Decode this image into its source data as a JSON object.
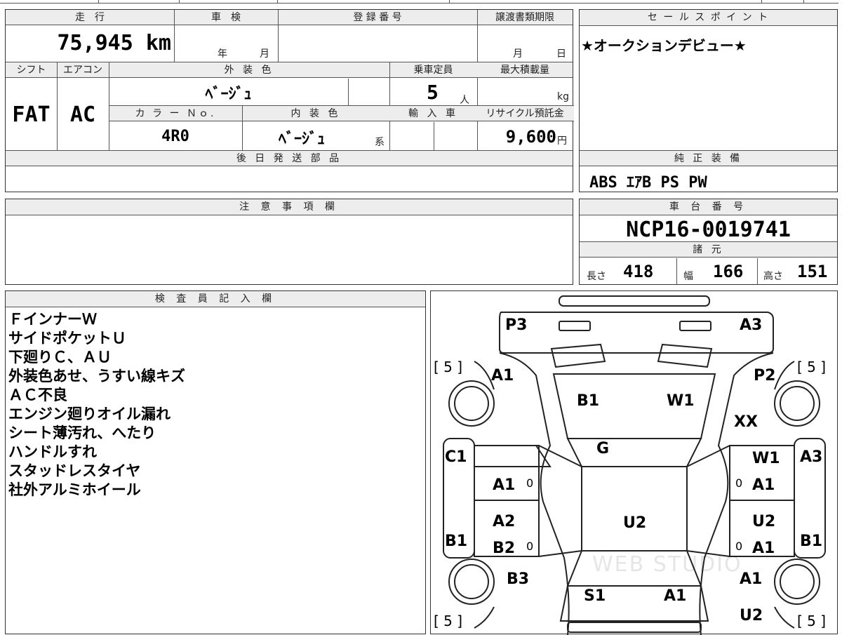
{
  "vehicle": {
    "mileage_label": "走　行",
    "mileage": "75,945 km",
    "shaken_label": "車　検",
    "shaken_year_unit": "年",
    "shaken_month_unit": "月",
    "registration_label": "登 録 番 号",
    "transfer_deadline_label": "譲渡書類期限",
    "transfer_month_unit": "月",
    "transfer_day_unit": "日",
    "shift_label": "シフト",
    "shift": "FAT",
    "aircon_label": "エアコン",
    "aircon": "AC",
    "exterior_color_label": "外 装 色",
    "exterior_color": "ﾍﾞｰｼﾞｭ",
    "capacity_label": "乗車定員",
    "capacity": "5",
    "capacity_unit": "人",
    "max_load_label": "最大積載量",
    "max_load_unit": "kg",
    "color_no_label": "カ ラ ー Ｎｏ.",
    "color_no": "4R0",
    "interior_color_label": "内 装 色",
    "interior_color": "ﾍﾞｰｼﾞｭ",
    "interior_suffix": "系",
    "import_label": "輸 入 車",
    "recycle_label": "リサイクル預託金",
    "recycle_fee": "9,600",
    "recycle_unit": "円",
    "later_parts_label": "後 日 発 送 部 品"
  },
  "sales_point": {
    "label": "セ ー ル ス ポ イ ン ト",
    "text": "★オークションデビュー★"
  },
  "equipment": {
    "label": "純 正 装 備",
    "text": "ABS ｴｱB PS PW"
  },
  "caution": {
    "label": "注 意 事 項 欄"
  },
  "chassis": {
    "label": "車 台 番 号",
    "number": "NCP16-0019741",
    "specs_label": "諸 元",
    "length_label": "長さ",
    "length": "418",
    "width_label": "幅",
    "width": "166",
    "height_label": "高さ",
    "height": "151"
  },
  "inspector": {
    "label": "検 査 員 記 入 欄",
    "lines": [
      "ＦインナーＷ",
      "サイドポケットＵ",
      "下廻りＣ、ＡＵ",
      "外装色あせ、うすい線キズ",
      "ＡＣ不良",
      "エンジン廻りオイル漏れ",
      "シート薄汚れ、へたり",
      "ハンドルすれ",
      "スタッドレスタイヤ",
      "社外アルミホイール"
    ]
  },
  "damage_map": {
    "tire_depth": [
      "[ 5 ]",
      "[ 5 ]",
      "[ 5 ]",
      "[ 5 ]"
    ],
    "codes": {
      "p3": "P3",
      "a3_top": "A3",
      "a1_front_left": "A1",
      "p2": "P2",
      "b1_hood": "B1",
      "w1_hood": "W1",
      "xx": "XX",
      "g": "G",
      "c1": "C1",
      "w1_right": "W1",
      "a3_right": "A3",
      "a1_left_door1": "A1",
      "zero_l1": "0",
      "zero_r1": "0",
      "a1_right_door1": "A1",
      "u2_roof": "U2",
      "a2_left": "A2",
      "u2_right": "U2",
      "b1_left": "B1",
      "b2_left": "B2",
      "zero_l2": "0",
      "zero_r2": "0",
      "a1_right_door2": "A1",
      "b1_right": "B1",
      "b3": "B3",
      "a1_rear_right": "A1",
      "s1": "S1",
      "a1_trunk": "A1",
      "u2_rear": "U2"
    },
    "watermark": "WEB STUDIO"
  }
}
